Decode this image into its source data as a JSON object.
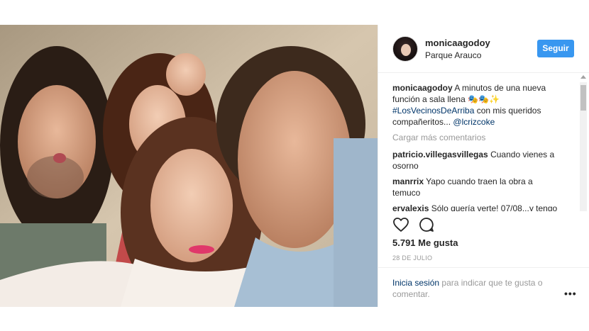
{
  "post": {
    "username": "monicaagodoy",
    "location": "Parque Arauco",
    "follow_label": "Seguir",
    "caption": {
      "user": "monicaagodoy",
      "text": "A minutos de una nueva función a sala llena 🎭🎭✨",
      "hashtag": "#LosVecinosDeArriba",
      "text2": "con mis queridos compañeritos...",
      "mention": "@lcrizcoke"
    },
    "load_more": "Cargar más comentarios",
    "comments": [
      {
        "user": "patricio.villegasvillegas",
        "text": "Cuando vienes a osorno"
      },
      {
        "user": "manrrix",
        "text": "Yapo cuando traen la obra a temuco"
      },
      {
        "user": "ervalexis",
        "text": "Sólo quería verte! 07/08...y tengo"
      }
    ],
    "likes": "5.791 Me gusta",
    "date": "28 DE JULIO",
    "login_link": "Inicia sesión",
    "login_text": "para indicar que te gusta o comentar.",
    "more_icon": "•••"
  },
  "icons": {
    "like": "heart-icon",
    "comment": "comment-icon",
    "more": "more-options-icon"
  },
  "colors": {
    "accent": "#3897f0",
    "link": "#003569",
    "muted": "#999999"
  }
}
